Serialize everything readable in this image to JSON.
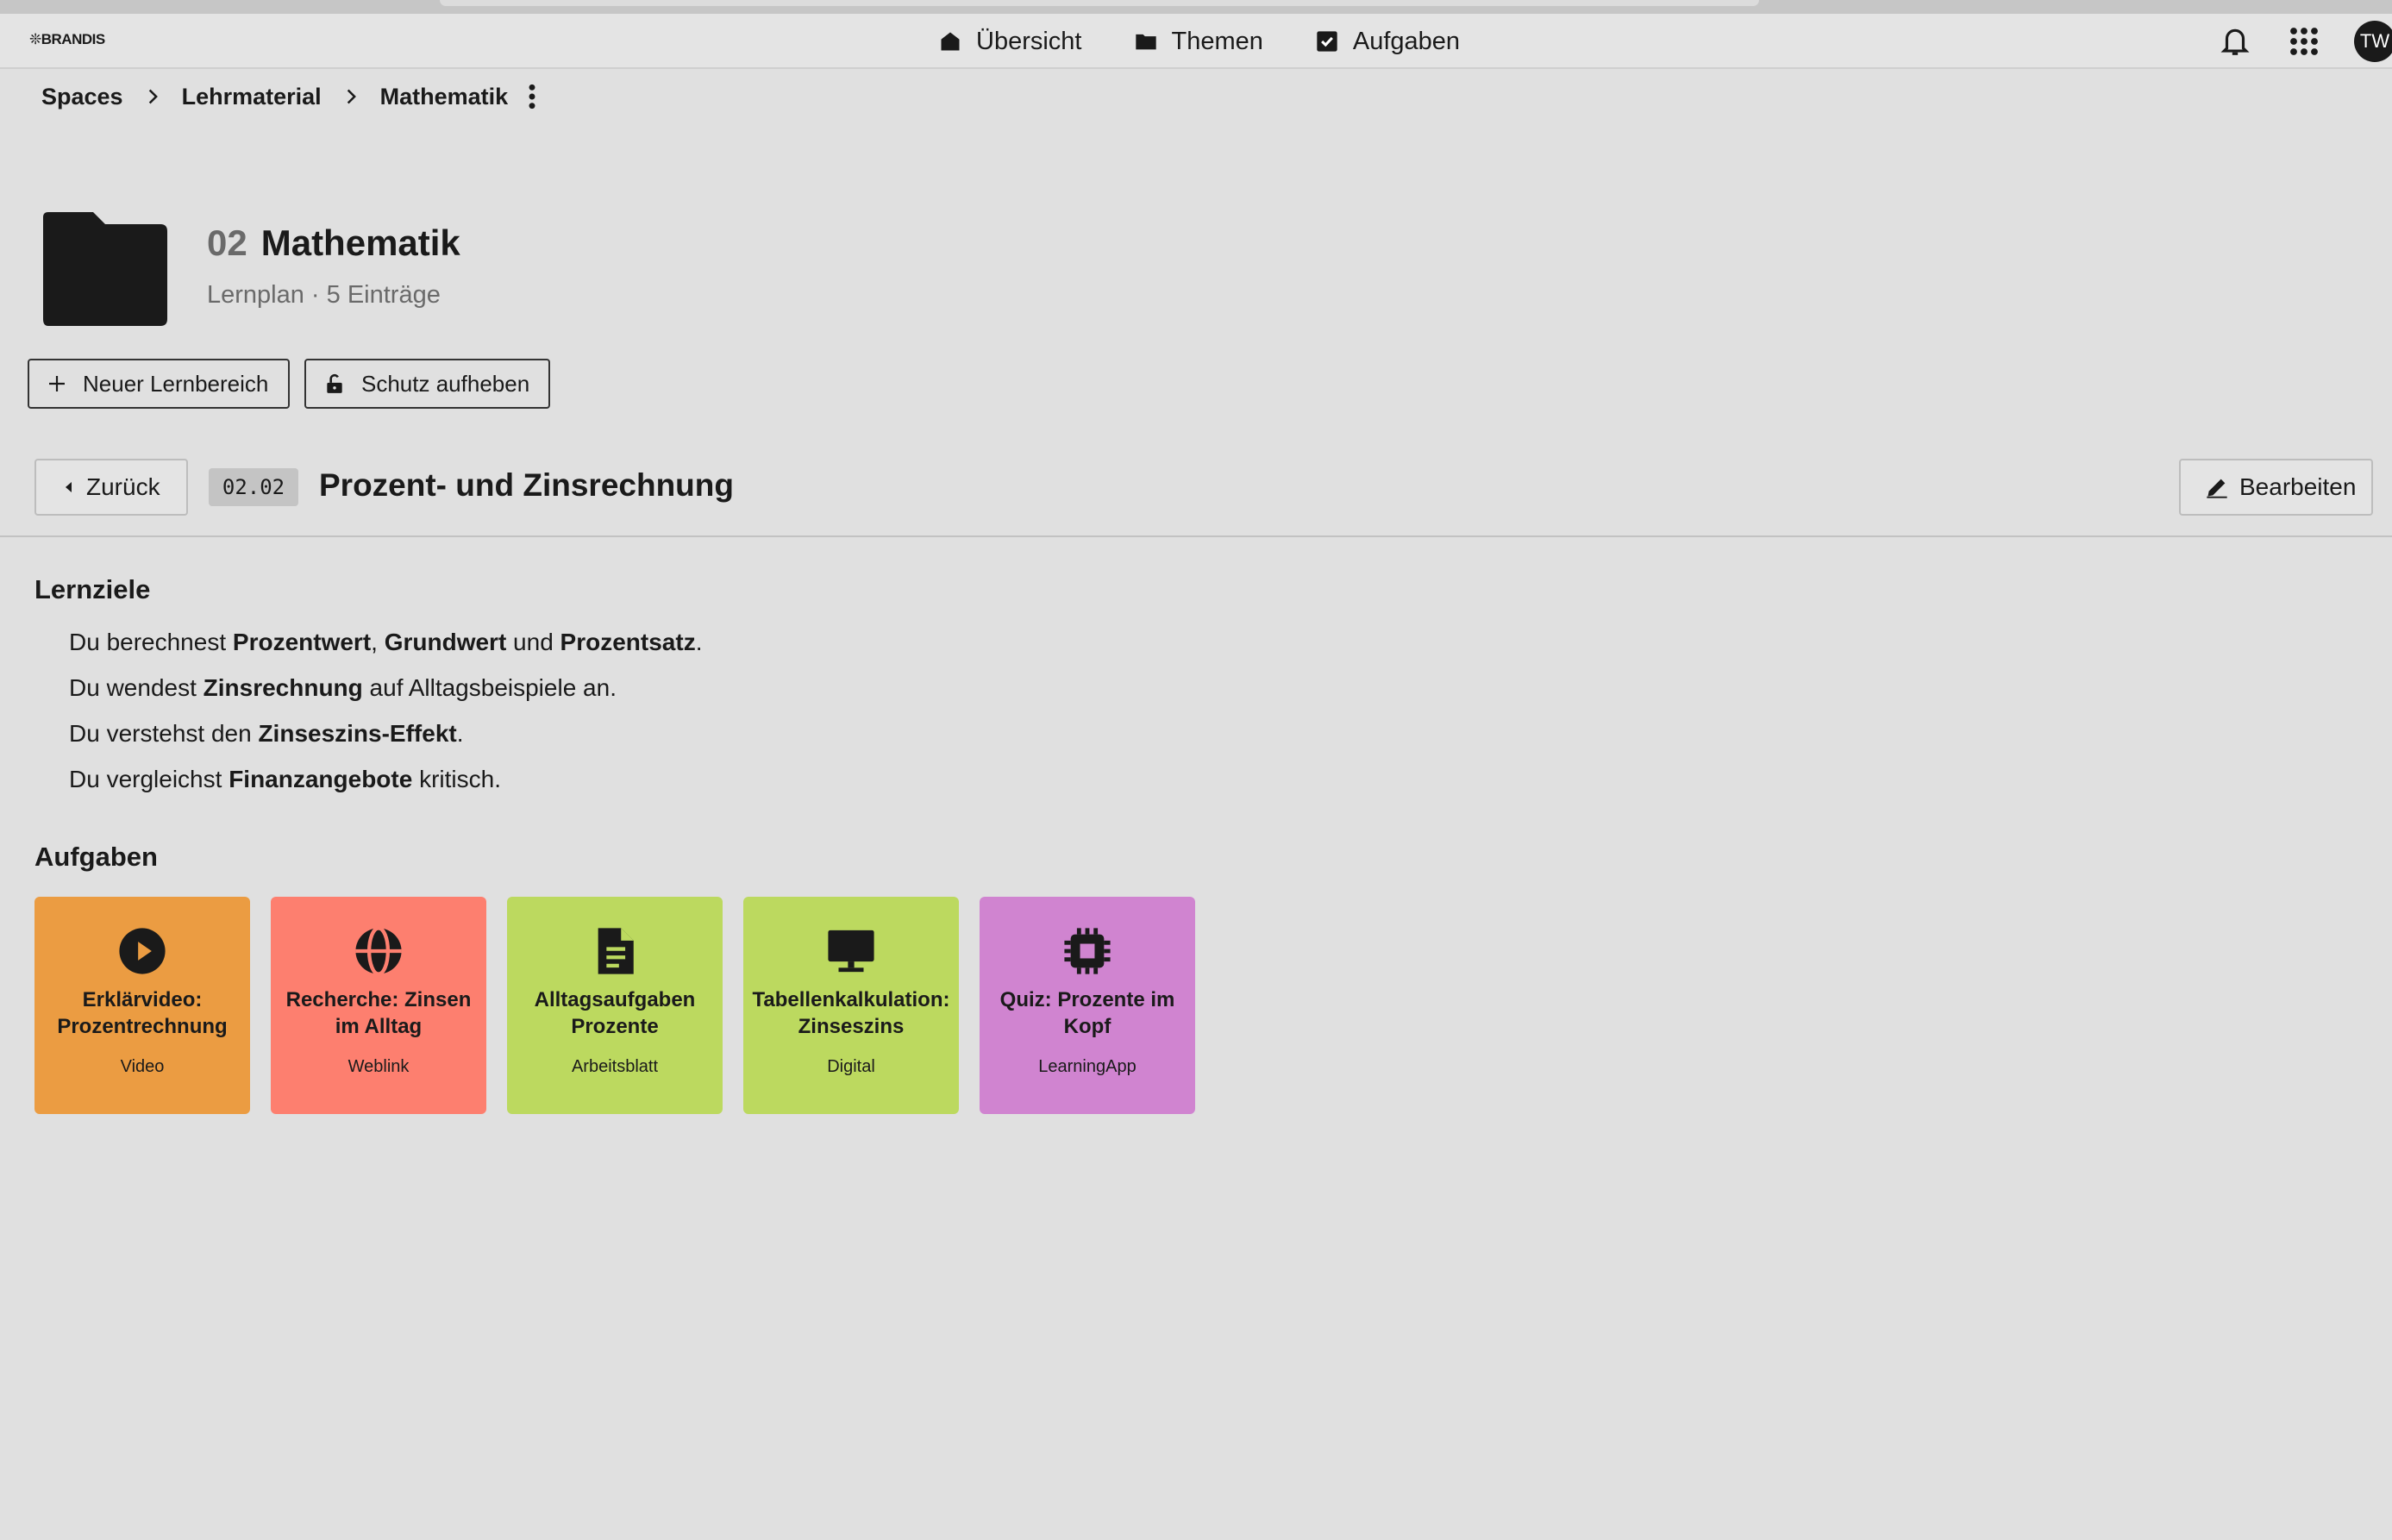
{
  "header": {
    "logo": "❊BRANDIS",
    "nav": [
      {
        "label": "Übersicht",
        "icon": "home-icon"
      },
      {
        "label": "Themen",
        "icon": "folder-icon"
      },
      {
        "label": "Aufgaben",
        "icon": "checkbox-icon"
      }
    ],
    "avatar_initials": "TW"
  },
  "breadcrumb": [
    "Spaces",
    "Lehrmaterial",
    "Mathematik"
  ],
  "space": {
    "number": "02",
    "name": "Mathematik",
    "subtitle": "Lernplan · 5 Einträge"
  },
  "actions": {
    "new_area": "Neuer Lernbereich",
    "unlock": "Schutz aufheben"
  },
  "section": {
    "back_label": "Zurück",
    "code": "02.02",
    "title": "Prozent- und Zinsrechnung",
    "edit_label": "Bearbeiten"
  },
  "goals": {
    "heading": "Lernziele",
    "items": [
      [
        "Du berechnest ",
        "Prozentwert",
        ", ",
        "Grundwert",
        " und ",
        "Prozentsatz",
        "."
      ],
      [
        "Du wendest ",
        "Zinsrechnung",
        " auf Alltagsbeispiele an."
      ],
      [
        "Du verstehst den ",
        "Zinseszins-Effekt",
        "."
      ],
      [
        "Du vergleichst ",
        "Finanzangebote",
        " kritisch."
      ]
    ]
  },
  "tasks": {
    "heading": "Aufgaben",
    "items": [
      {
        "title": "Erklärvideo: Prozentrechnung",
        "type": "Video",
        "icon": "play-circle-icon",
        "color": "#eb9c42"
      },
      {
        "title": "Recherche: Zinsen im Alltag",
        "type": "Weblink",
        "icon": "globe-icon",
        "color": "#fd7f6f"
      },
      {
        "title": "Alltagsaufgaben Prozente",
        "type": "Arbeitsblatt",
        "icon": "document-icon",
        "color": "#bcd95f"
      },
      {
        "title": "Tabellenkalkulation: Zinseszins",
        "type": "Digital",
        "icon": "monitor-icon",
        "color": "#bcd95f"
      },
      {
        "title": "Quiz: Prozente im Kopf",
        "type": "LearningApp",
        "icon": "chip-icon",
        "color": "#d084d0"
      }
    ]
  }
}
